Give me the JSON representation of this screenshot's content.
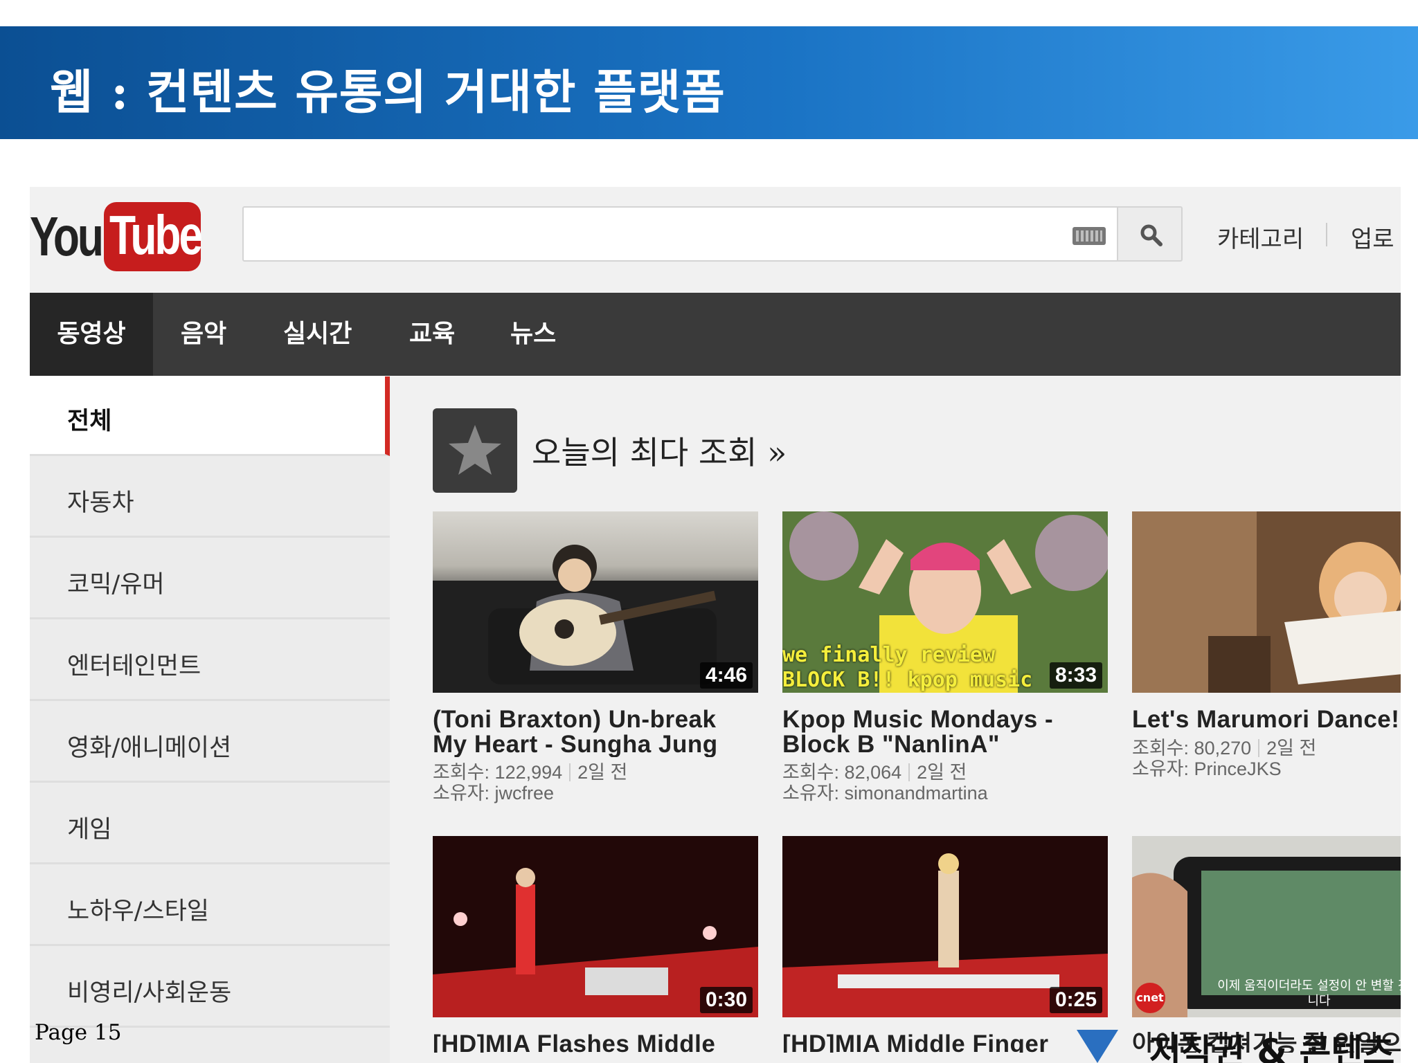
{
  "slide": {
    "title": "웹 : 컨텐츠 유통의 거대한 플랫폼",
    "page_label": "Page 15",
    "corner_text": "저작권 & 콘텐츠",
    "colors": {
      "banner_dark": "#0b4f93",
      "banner_light": "#3a9be8"
    }
  },
  "youtube": {
    "logo": {
      "you": "You",
      "tube": "Tube",
      "brand_color": "#c61d1d"
    },
    "search": {
      "value": "",
      "placeholder": ""
    },
    "top_links": [
      "카테고리",
      "업로"
    ],
    "nav_tabs": [
      "동영상",
      "음악",
      "실시간",
      "교육",
      "뉴스"
    ],
    "nav_active": "동영상",
    "sidebar": [
      "전체",
      "자동차",
      "코믹/유머",
      "엔터테인먼트",
      "영화/애니메이션",
      "게임",
      "노하우/스타일",
      "비영리/사회운동"
    ],
    "sidebar_active": "전체",
    "accent_color": "#d22a24",
    "section_title": "오늘의 최다 조회 »",
    "videos": [
      {
        "duration": "4:46",
        "title_lines": [
          "(Toni Braxton) Un-break",
          "My Heart - Sungha Jung"
        ],
        "views_label": "조회수:",
        "views": "122,994",
        "age": "2일 전",
        "owner_label": "소유자:",
        "owner": "jwcfree",
        "thumb_caption": ""
      },
      {
        "duration": "8:33",
        "title_lines": [
          "Kpop Music Mondays -",
          "Block B \"NanlinA\""
        ],
        "views_label": "조회수:",
        "views": "82,064",
        "age": "2일 전",
        "owner_label": "소유자:",
        "owner": "simonandmartina",
        "thumb_caption": "we finally review BLOCK B!! kpop music mondays"
      },
      {
        "duration": "",
        "title_lines": [
          "Let's Marumori Dance!"
        ],
        "views_label": "조회수:",
        "views": "80,270",
        "age": "2일 전",
        "owner_label": "소유자:",
        "owner": "PrinceJKS",
        "thumb_caption": ""
      },
      {
        "duration": "0:30",
        "title_lines": [
          "[HD]MIA Flashes Middle"
        ],
        "views_label": "",
        "views": "",
        "age": "",
        "owner_label": "",
        "owner": "",
        "thumb_caption": ""
      },
      {
        "duration": "0:25",
        "title_lines": [
          "[HD]MIA Middle Finger"
        ],
        "views_label": "",
        "views": "",
        "age": "",
        "owner_label": "",
        "owner": "",
        "thumb_caption": ""
      },
      {
        "duration": "",
        "title_lines": [
          "아이폰 캡쳐기능 잘 안알으"
        ],
        "views_label": "",
        "views": "",
        "age": "",
        "owner_label": "",
        "owner": "",
        "thumb_caption": "이제 움직이더라도 설정이 안 변할 것입니다",
        "badge": "cnet"
      }
    ]
  }
}
